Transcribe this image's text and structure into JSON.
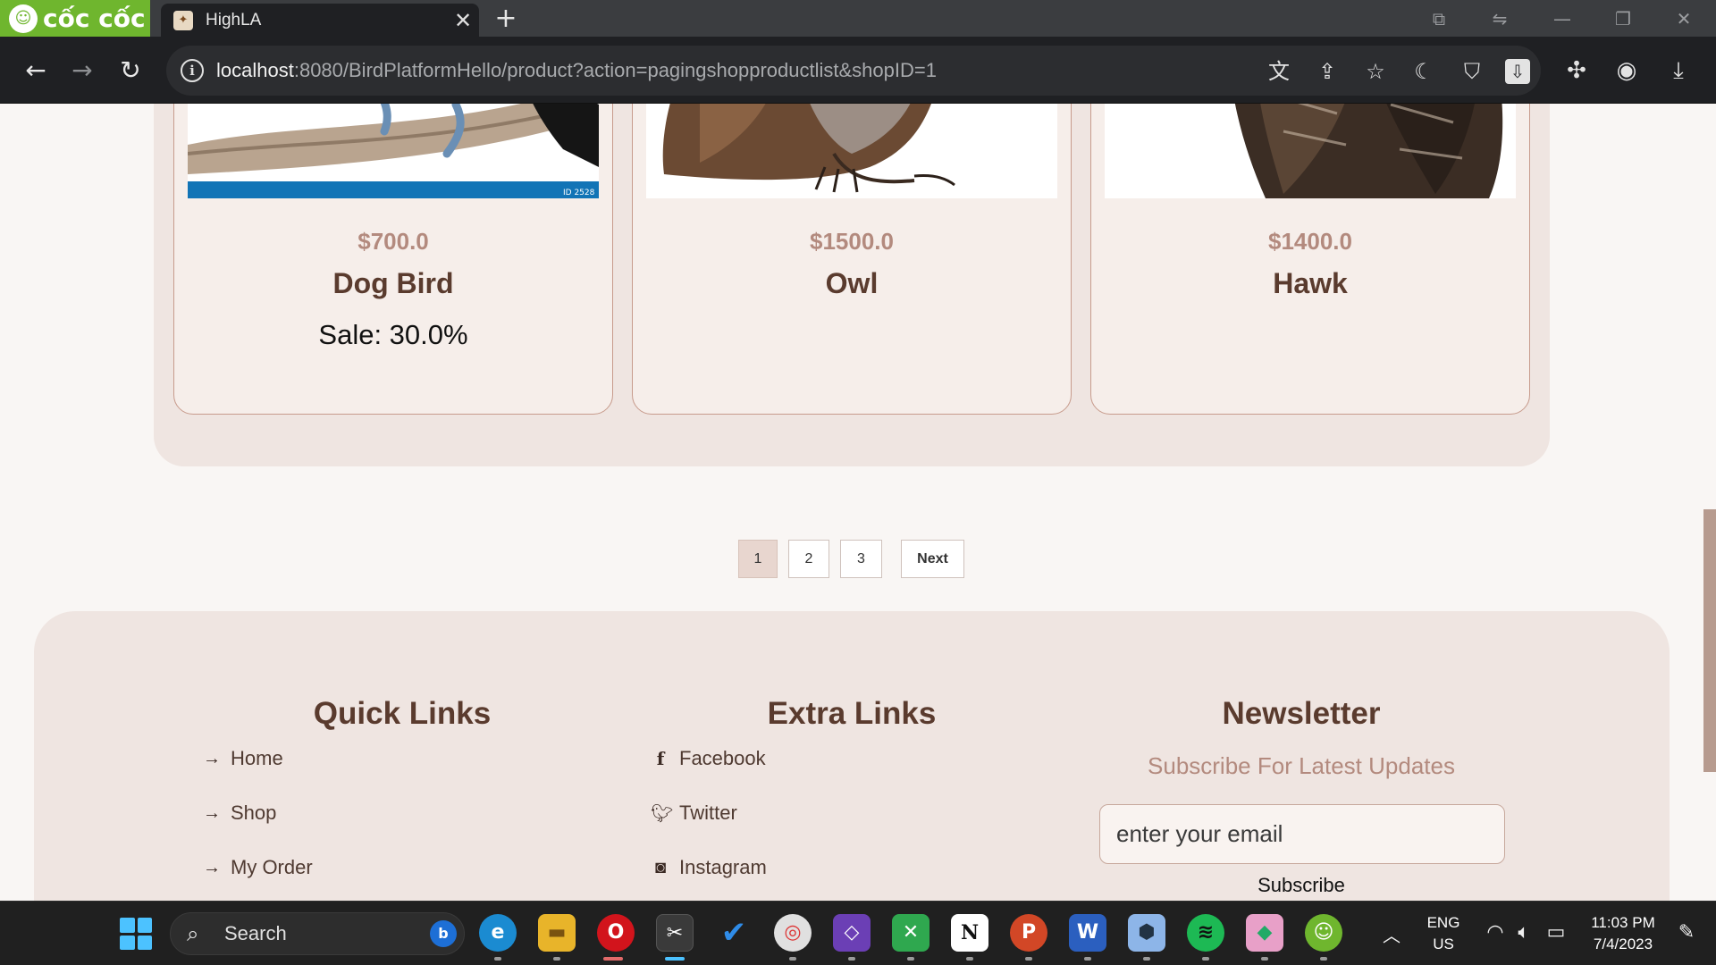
{
  "browser": {
    "brand": "cốc cốc",
    "tab_title": "HighLA",
    "url_host": "localhost",
    "url_rest": ":8080/BirdPlatformHello/product?action=pagingshopproductlist&shopID=1"
  },
  "products": [
    {
      "price": "$700.0",
      "name": "Dog Bird",
      "sale": "Sale: 30.0%"
    },
    {
      "price": "$1500.0",
      "name": "Owl",
      "sale": ""
    },
    {
      "price": "$1400.0",
      "name": "Hawk",
      "sale": ""
    }
  ],
  "pagination": {
    "pages": [
      "1",
      "2",
      "3"
    ],
    "current": "1",
    "next": "Next"
  },
  "footer": {
    "quick_links": {
      "title": "Quick Links",
      "items": [
        "Home",
        "Shop",
        "My Order"
      ]
    },
    "extra_links": {
      "title": "Extra Links",
      "items": [
        "Facebook",
        "Twitter",
        "Instagram"
      ]
    },
    "newsletter": {
      "title": "Newsletter",
      "subtitle": "Subscribe For Latest Updates",
      "email_placeholder": "enter your email",
      "button": "Subscribe"
    }
  },
  "taskbar": {
    "search_label": "Search",
    "lang_top": "ENG",
    "lang_bottom": "US",
    "time": "11:03 PM",
    "date": "7/4/2023"
  },
  "colors": {
    "accent": "#b38a7e",
    "heading": "#5a3b2e",
    "panel": "#efe5e1"
  }
}
